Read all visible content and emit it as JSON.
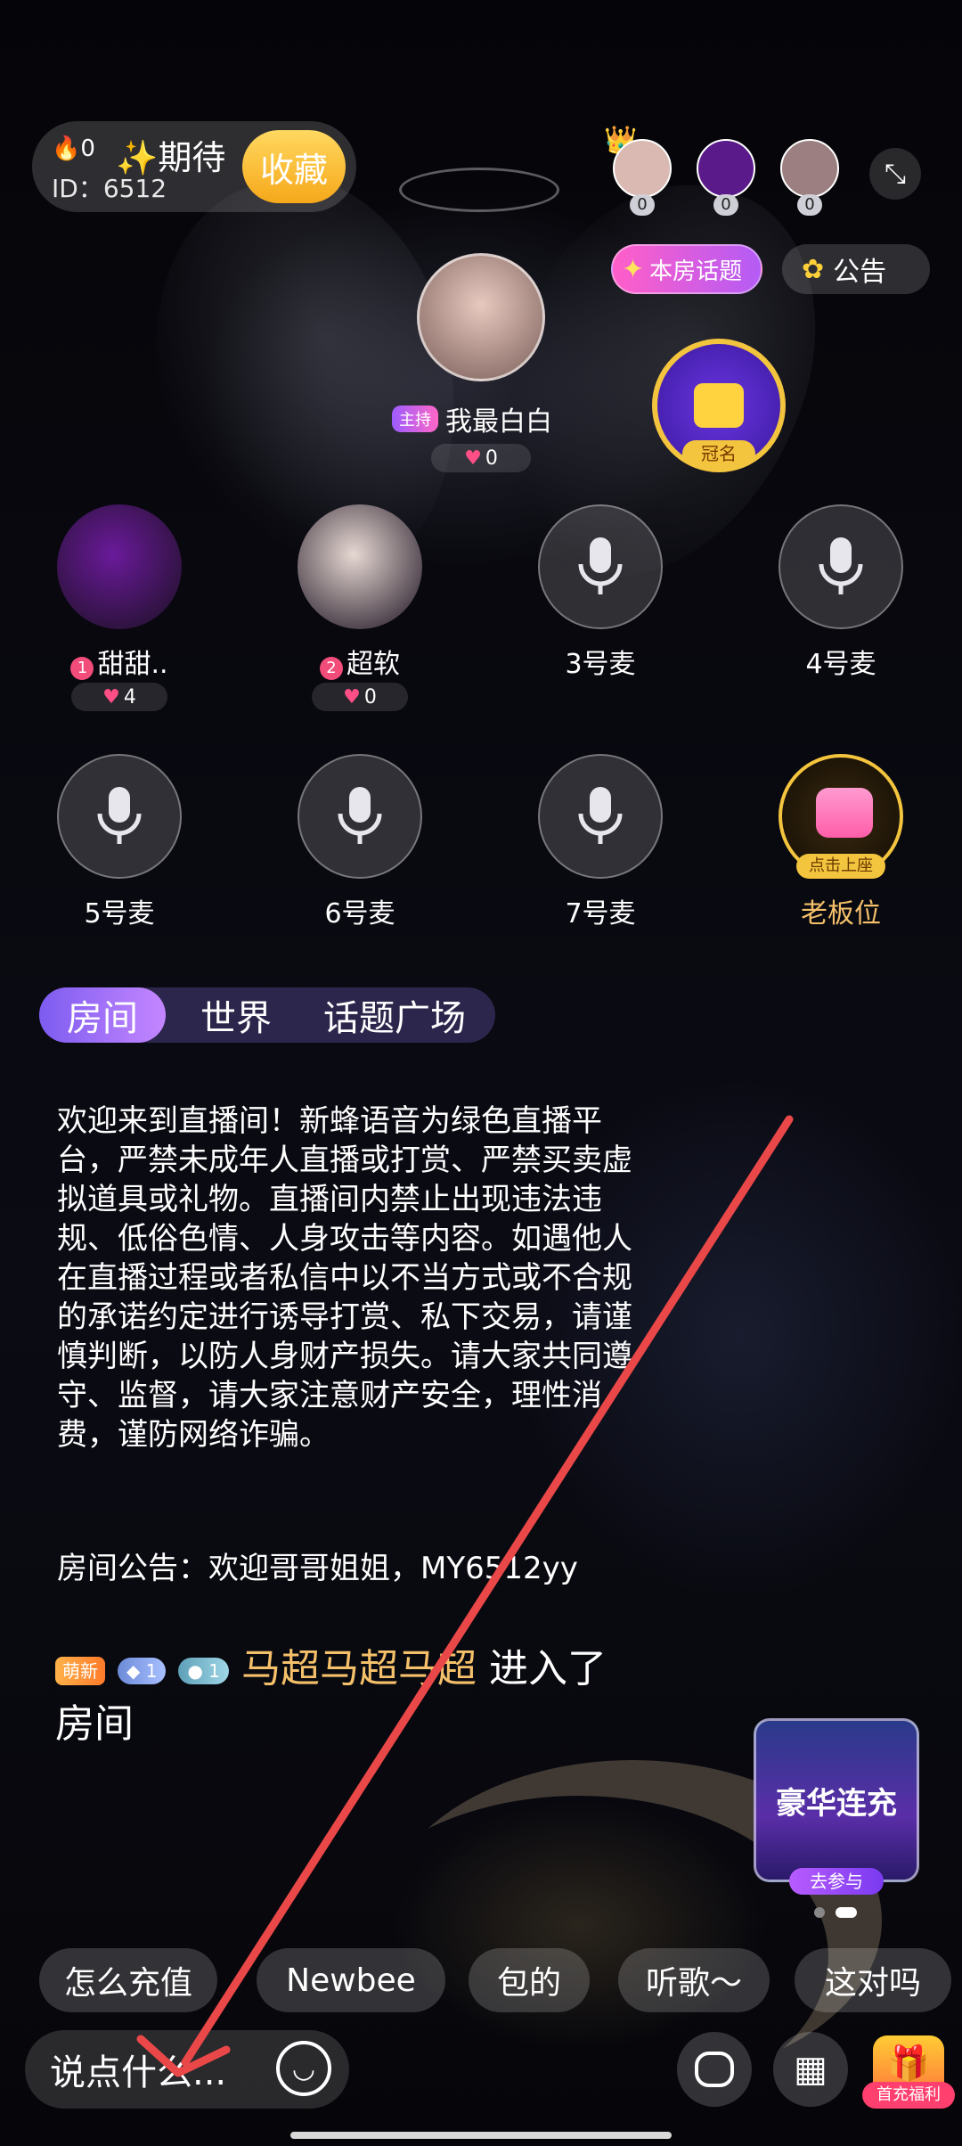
{
  "room": {
    "heat_value": "0",
    "id_label": "ID：6512",
    "name": "✨期待",
    "collect_label": "收藏",
    "topic_label": "本房话题",
    "announcement_label": "公告"
  },
  "top_users": [
    {
      "name": "top-user-1",
      "score": "0",
      "color": "#d9b9b2"
    },
    {
      "name": "top-user-2",
      "score": "0",
      "color": "#5a1a8a"
    },
    {
      "name": "top-user-3",
      "score": "0",
      "color": "#9c7f80"
    }
  ],
  "host": {
    "role_badge": "主持",
    "name": "我最白白",
    "hearts": "0"
  },
  "crown_badge_label": "冠名",
  "seats": [
    {
      "label": "甜甜..",
      "rank": "1",
      "hearts": "4",
      "occupied": true,
      "color": "#6a1a9a"
    },
    {
      "label": "超软",
      "rank": "2",
      "hearts": "0",
      "occupied": true,
      "color": "#e6d8d2"
    },
    {
      "label": "3号麦",
      "occupied": false
    },
    {
      "label": "4号麦",
      "occupied": false
    },
    {
      "label": "5号麦",
      "occupied": false
    },
    {
      "label": "6号麦",
      "occupied": false
    },
    {
      "label": "7号麦",
      "occupied": false
    },
    {
      "label": "老板位",
      "tag": "点击上座",
      "occupied": false,
      "boss": true
    }
  ],
  "tabs": [
    {
      "label": "房间",
      "active": true
    },
    {
      "label": "世界",
      "active": false
    },
    {
      "label": "话题广场",
      "active": false
    }
  ],
  "chat": {
    "welcome": "欢迎来到直播间！新蜂语音为绿色直播平台，严禁未成年人直播或打赏、严禁买卖虚拟道具或礼物。直播间内禁止出现违法违规、低俗色情、人身攻击等内容。如遇他人在直播过程或者私信中以不当方式或不合规的承诺约定进行诱导打赏、私下交易，请谨慎判断，以防人身财产损失。请大家共同遵守、监督，请大家注意财产安全，理性消费，谨防网络诈骗。",
    "room_announcement": "房间公告：欢迎哥哥姐姐，MY6512yy",
    "entry": {
      "newbie_badge": "萌新",
      "level1": "1",
      "level2": "1",
      "user": "马超马超马超",
      "action": "进入了房间"
    }
  },
  "promo": {
    "title": "豪华连充",
    "cta": "去参与"
  },
  "quick_replies": [
    "怎么充值",
    "Newbee",
    "包的",
    "听歌～",
    "这对吗"
  ],
  "input": {
    "placeholder": "说点什么..."
  },
  "first_recharge_label": "首充福利",
  "colors": {
    "accent_purple": "#7d5cf0",
    "gold": "#f6c040",
    "heart": "#ff4f86",
    "name_gold": "#f5c06a"
  }
}
